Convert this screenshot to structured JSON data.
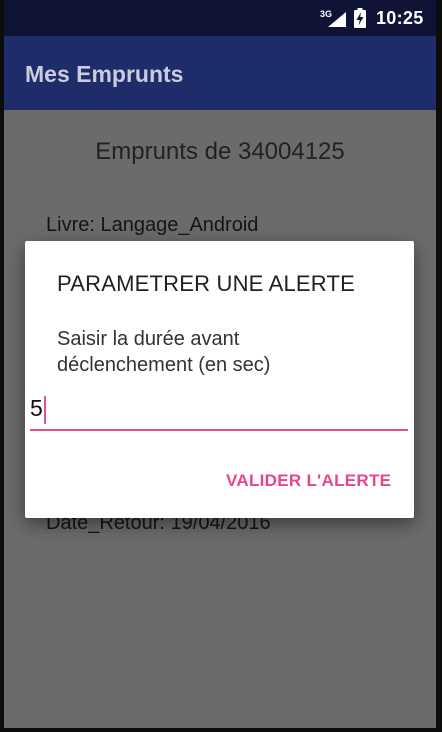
{
  "status_bar": {
    "network_label": "3G",
    "time": "10:25",
    "icons": [
      "signal-icon",
      "battery-charging-icon"
    ]
  },
  "app_bar": {
    "title": "Mes Emprunts"
  },
  "main": {
    "heading": "Emprunts de 34004125",
    "book_line": "Livre: Langage_Android",
    "return_date_line": "Date_Retour: 19/04/2016"
  },
  "dialog": {
    "title": "PARAMETRER UNE ALERTE",
    "message": "Saisir la durée avant déclenchement (en sec)",
    "input_value": "5",
    "confirm_label": "VALIDER L'ALERTE"
  },
  "colors": {
    "status_bar": "#0f1437",
    "app_bar": "#1f2c6a",
    "scrim_content": "#6b6b6b",
    "accent": "#e14f8c",
    "dialog_background": "#ffffff"
  }
}
